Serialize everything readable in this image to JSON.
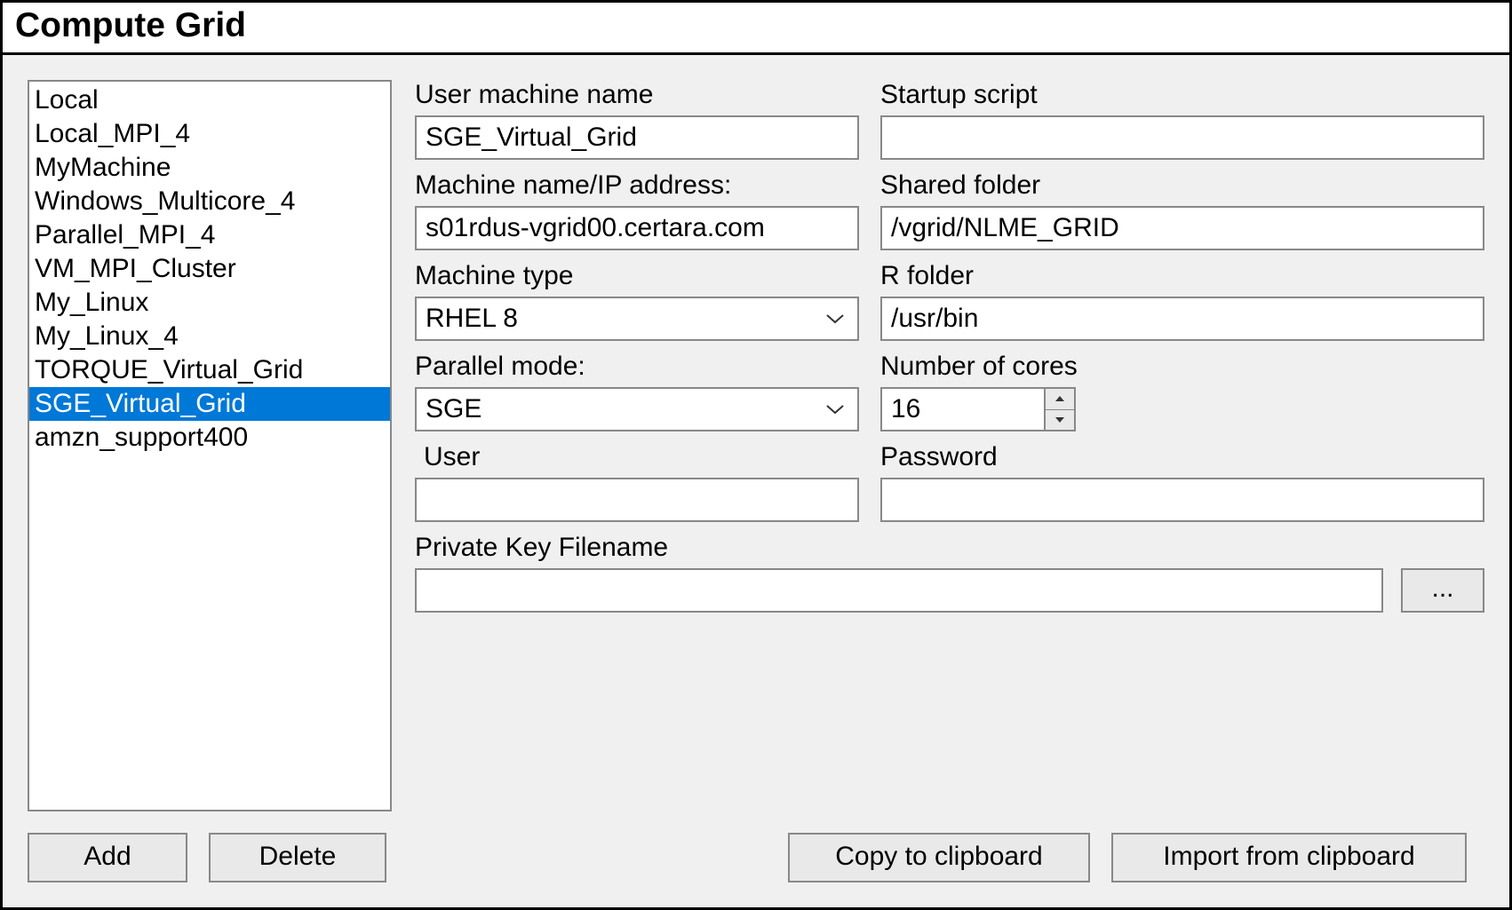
{
  "window": {
    "title": "Compute Grid"
  },
  "list": {
    "items": [
      "Local",
      "Local_MPI_4",
      "MyMachine",
      "Windows_Multicore_4",
      "Parallel_MPI_4",
      "VM_MPI_Cluster",
      "My_Linux",
      "My_Linux_4",
      "TORQUE_Virtual_Grid",
      "SGE_Virtual_Grid",
      "amzn_support400"
    ],
    "selected_index": 9
  },
  "form": {
    "user_machine_name": {
      "label": "User machine name",
      "value": "SGE_Virtual_Grid"
    },
    "startup_script": {
      "label": "Startup script",
      "value": ""
    },
    "machine_ip": {
      "label": "Machine name/IP address:",
      "value": "s01rdus-vgrid00.certara.com"
    },
    "shared_folder": {
      "label": "Shared folder",
      "value": "/vgrid/NLME_GRID"
    },
    "machine_type": {
      "label": "Machine type",
      "value": "RHEL 8"
    },
    "r_folder": {
      "label": "R folder",
      "value": "/usr/bin"
    },
    "parallel_mode": {
      "label": "Parallel mode:",
      "value": "SGE"
    },
    "num_cores": {
      "label": "Number of cores",
      "value": "16"
    },
    "user": {
      "label": "User",
      "value": ""
    },
    "password": {
      "label": "Password",
      "value": ""
    },
    "private_key": {
      "label": "Private Key Filename",
      "value": ""
    }
  },
  "buttons": {
    "add": "Add",
    "delete": "Delete",
    "copy": "Copy to clipboard",
    "import": "Import from clipboard",
    "browse": "..."
  }
}
